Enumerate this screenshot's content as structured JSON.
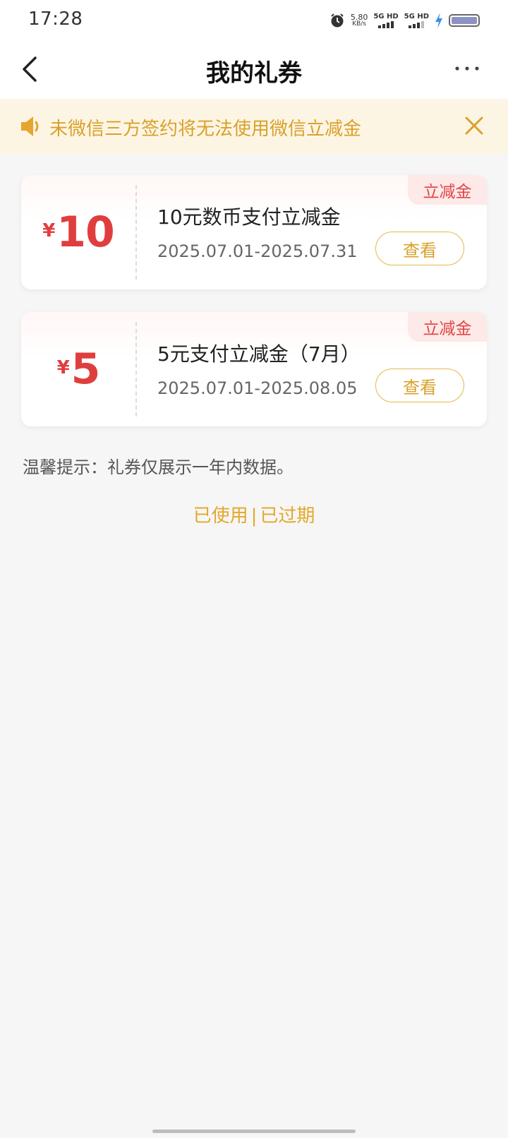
{
  "status": {
    "time": "17:28",
    "net_speed": "5.80",
    "net_unit": "KB/s",
    "sim1": "5G HD",
    "sim2": "5G HD"
  },
  "header": {
    "title": "我的礼券"
  },
  "notice": {
    "text": "未微信三方签约将无法使用微信立减金"
  },
  "coupons": [
    {
      "currency": "¥",
      "amount": "10",
      "name": "10元数币支付立减金",
      "date": "2025.07.01-2025.07.31",
      "tag": "立减金",
      "button": "查看"
    },
    {
      "currency": "¥",
      "amount": "5",
      "name": "5元支付立减金（7月）",
      "date": "2025.07.01-2025.08.05",
      "tag": "立减金",
      "button": "查看"
    }
  ],
  "tip": "温馨提示：礼券仅展示一年内数据。",
  "links": {
    "used": "已使用",
    "separator": "|",
    "expired": "已过期"
  },
  "colors": {
    "accent": "#e3a82a",
    "amount_red": "#e03e3e",
    "notice_bg": "#fdf5e4"
  }
}
